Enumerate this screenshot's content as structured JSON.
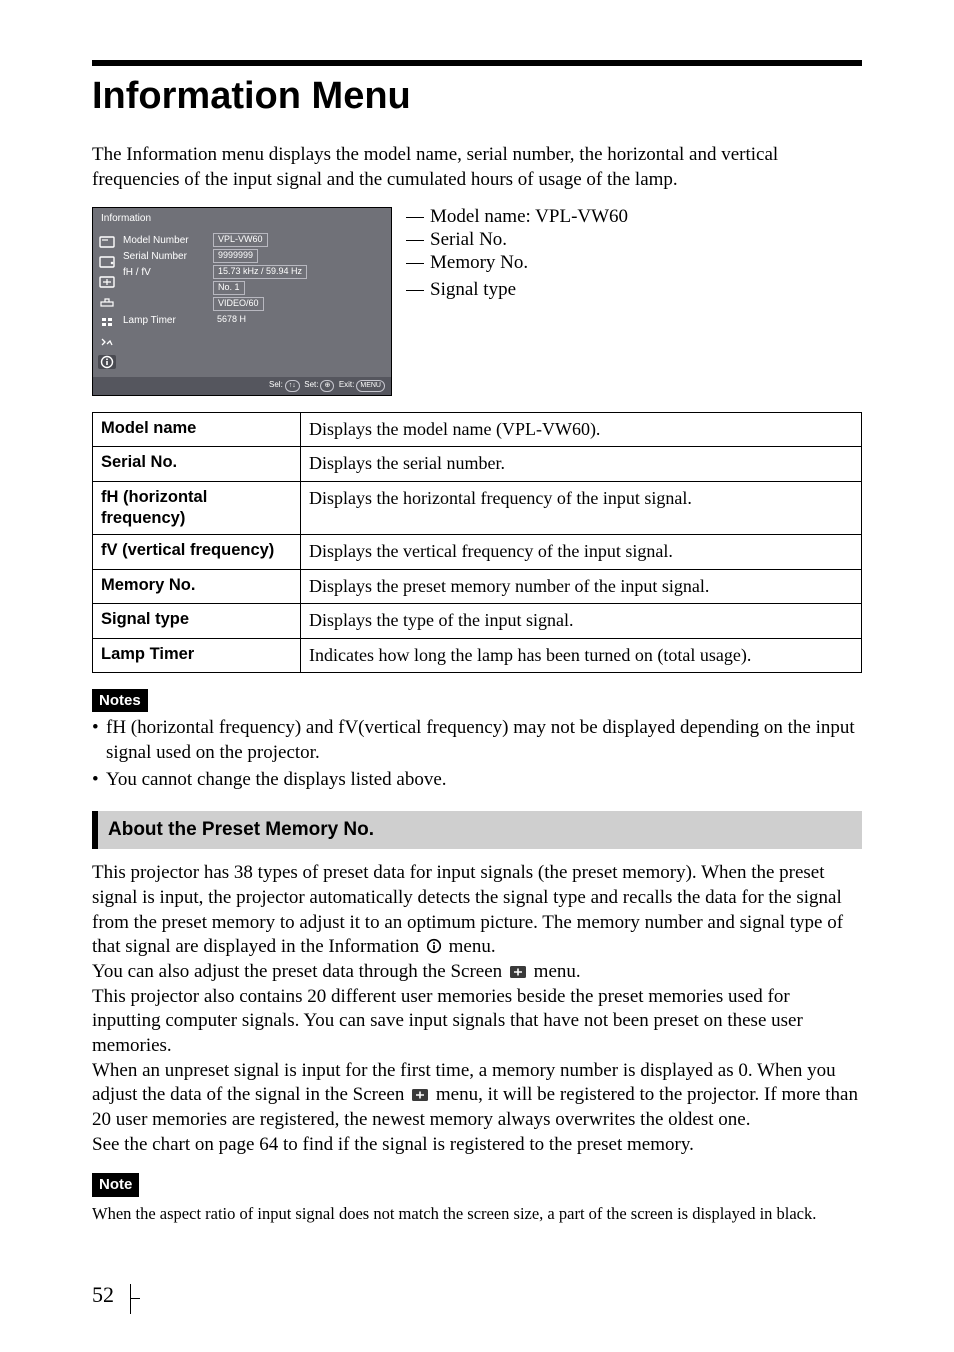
{
  "title": "Information Menu",
  "intro": "The Information menu displays the model name, serial number, the horizontal and vertical frequencies of the input signal and the cumulated hours of usage of the lamp.",
  "osd": {
    "title": "Information",
    "rows": {
      "model_label": "Model Number",
      "model_value": "VPL-VW60",
      "serial_label": "Serial Number",
      "serial_value": "9999999",
      "fhfv_label": "fH / fV",
      "fhfv_value": "15.73 kHz / 59.94 Hz",
      "memory_value": "No. 1",
      "signal_value": "VIDEO/60",
      "lamp_label": "Lamp Timer",
      "lamp_value": "5678 H"
    },
    "footer": {
      "sel": "Sel:",
      "sel_k": "↑↓",
      "set": "Set:",
      "set_k": "⊕",
      "exit": "Exit:",
      "exit_k": "MENU"
    }
  },
  "callouts": {
    "model": "Model name: VPL-VW60",
    "serial": "Serial No.",
    "memory": "Memory No.",
    "signal": "Signal type"
  },
  "table": {
    "r1": {
      "h": "Model name",
      "d": "Displays the model name (VPL-VW60)."
    },
    "r2": {
      "h": "Serial No.",
      "d": "Displays the serial number."
    },
    "r3": {
      "h": "fH (horizontal frequency)",
      "d": "Displays the horizontal frequency of the input signal."
    },
    "r4": {
      "h": "fV (vertical frequency)",
      "d": "Displays the vertical frequency of the input signal."
    },
    "r5": {
      "h": "Memory No.",
      "d": "Displays the preset memory number of the input signal."
    },
    "r6": {
      "h": "Signal type",
      "d": "Displays the type of the input signal."
    },
    "r7": {
      "h": "Lamp Timer",
      "d": "Indicates how long the lamp has been turned on (total usage)."
    }
  },
  "notes_label": "Notes",
  "notes": {
    "n1": "fH (horizontal frequency) and fV(vertical frequency) may not be displayed depending on the input signal used on the projector.",
    "n2": "You cannot change the displays listed above."
  },
  "section": "About the Preset Memory No.",
  "body": {
    "p1a": "This projector has 38 types of preset data for input signals (the preset memory). When the preset signal is input, the projector automatically detects the signal type and recalls the data for the signal from the preset memory to adjust it to an optimum picture. The memory number and signal type of that signal are displayed in the Information ",
    "p1b": " menu.",
    "p2a": "You can also adjust the preset data through the Screen ",
    "p2b": " menu.",
    "p3": "This projector also contains 20 different user memories beside the preset memories used for inputting computer signals. You can save input signals that have not been preset on these user memories.",
    "p4a": "When an unpreset signal is input for the first time, a memory number is displayed as 0. When you adjust the data of the signal in the Screen ",
    "p4b": " menu, it will be registered to the projector. If more than 20 user memories are registered, the newest memory always overwrites the oldest one.",
    "p5": "See the chart on page 64 to find if the signal is registered to the preset memory."
  },
  "note_label": "Note",
  "note_text": "When the aspect ratio of input signal does not match the screen size, a part of the screen is displayed in black.",
  "page": "52"
}
